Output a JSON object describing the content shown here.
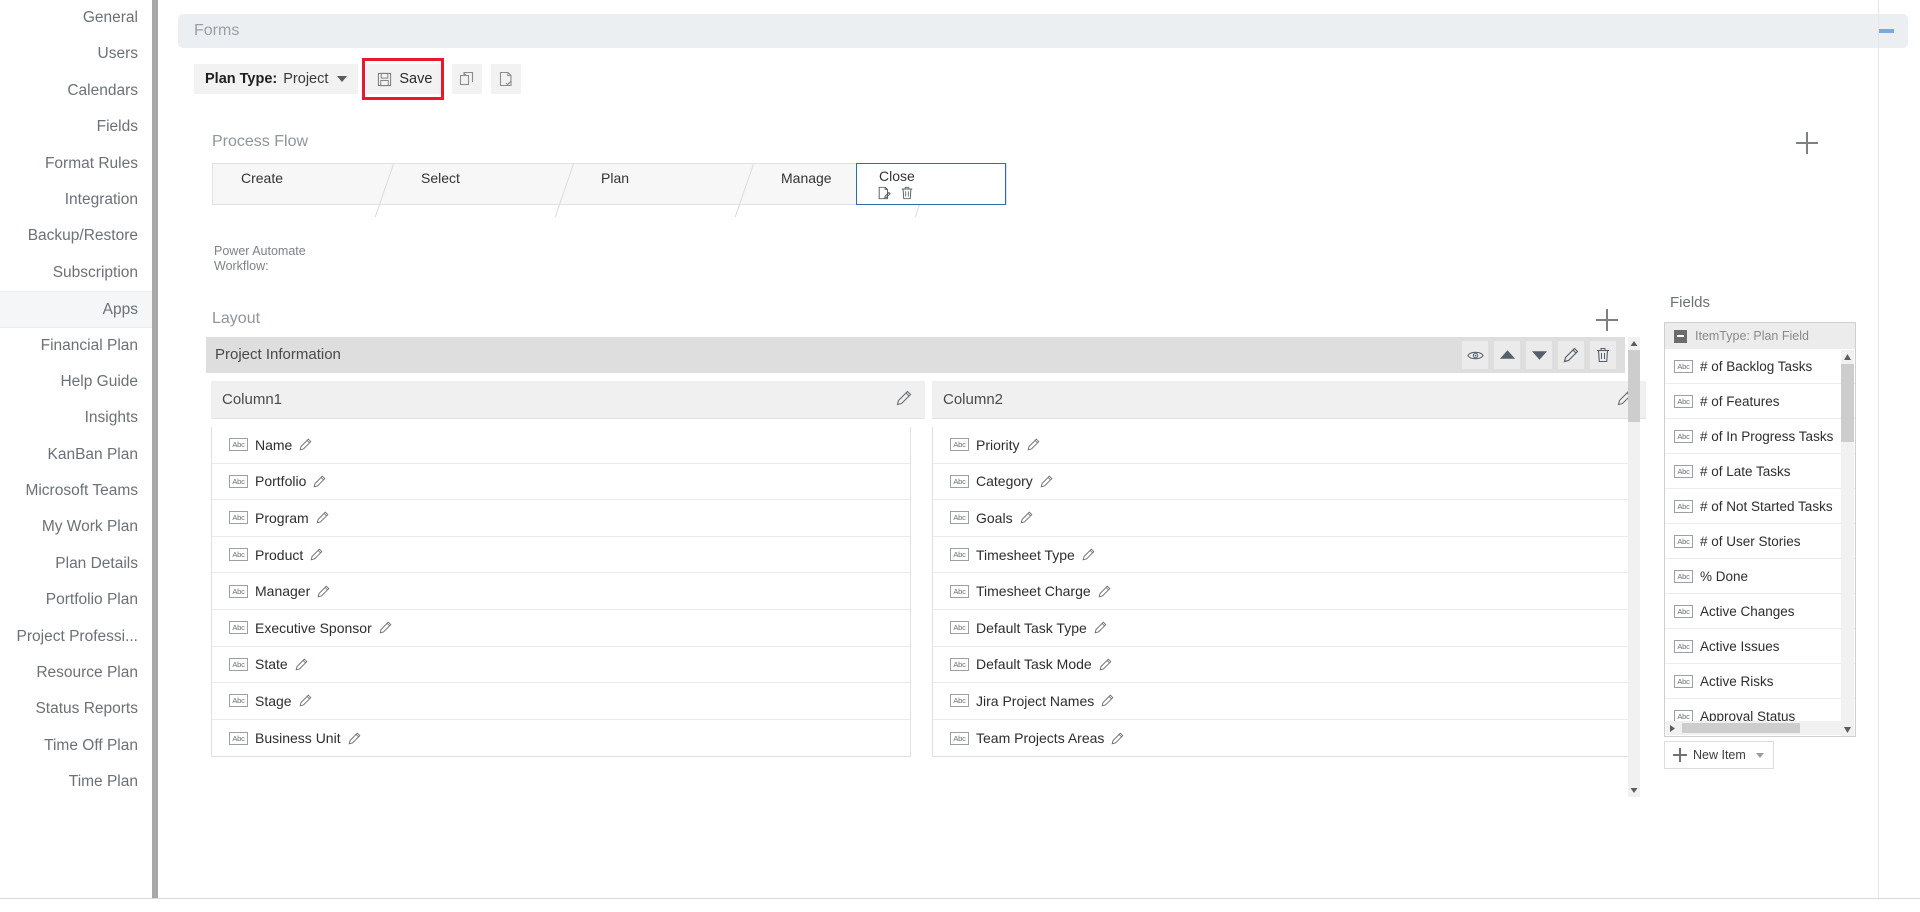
{
  "sidebar": {
    "items": [
      {
        "label": "General",
        "state": "normal"
      },
      {
        "label": "Users",
        "state": "normal"
      },
      {
        "label": "Calendars",
        "state": "normal"
      },
      {
        "label": "Fields",
        "state": "normal"
      },
      {
        "label": "Format Rules",
        "state": "normal"
      },
      {
        "label": "Integration",
        "state": "normal"
      },
      {
        "label": "Backup/Restore",
        "state": "normal"
      },
      {
        "label": "Subscription",
        "state": "normal"
      },
      {
        "label": "Apps",
        "state": "selected"
      },
      {
        "label": "Financial Plan",
        "state": "normal"
      },
      {
        "label": "Help Guide",
        "state": "normal"
      },
      {
        "label": "Insights",
        "state": "normal"
      },
      {
        "label": "KanBan Plan",
        "state": "normal"
      },
      {
        "label": "Microsoft Teams",
        "state": "normal"
      },
      {
        "label": "My Work Plan",
        "state": "normal"
      },
      {
        "label": "Plan Details",
        "state": "active"
      },
      {
        "label": "Portfolio Plan",
        "state": "normal"
      },
      {
        "label": "Project Professi...",
        "state": "normal"
      },
      {
        "label": "Resource Plan",
        "state": "normal"
      },
      {
        "label": "Status Reports",
        "state": "normal"
      },
      {
        "label": "Time Off Plan",
        "state": "normal"
      },
      {
        "label": "Time Plan",
        "state": "normal"
      }
    ]
  },
  "window": {
    "title": "Forms",
    "minimize_icon": "minimize-icon"
  },
  "toolbar": {
    "plan_type_label": "Plan Type:",
    "plan_type_value": "Project",
    "save_label": "Save",
    "save_icon": "floppy-disk-icon",
    "copy_icon": "copy-icon",
    "new-doc_icon": "new-document-icon",
    "highlight_color": "#e8192c"
  },
  "process_flow": {
    "title": "Process Flow",
    "add_icon": "plus-icon",
    "steps": [
      {
        "label": "Create",
        "selected": false
      },
      {
        "label": "Select",
        "selected": false
      },
      {
        "label": "Plan",
        "selected": false
      },
      {
        "label": "Manage",
        "selected": false
      },
      {
        "label": "Close",
        "selected": true
      }
    ],
    "selected_step_icons": [
      "edit-document-icon",
      "trash-icon"
    ],
    "selected_border_color": "#2e6da4"
  },
  "power_automate": {
    "label": "Power Automate Workflow:",
    "value": "",
    "caret_icon": "caret-down-icon"
  },
  "layout": {
    "title": "Layout",
    "add_icon": "plus-icon",
    "section_title": "Project Information",
    "section_tools": [
      {
        "icon": "eye-icon",
        "name": "visibility"
      },
      {
        "icon": "arrow-up-icon",
        "name": "move-up"
      },
      {
        "icon": "arrow-down-icon",
        "name": "move-down"
      },
      {
        "icon": "pencil-icon",
        "name": "edit"
      },
      {
        "icon": "trash-icon",
        "name": "delete"
      }
    ],
    "columns": [
      {
        "header": "Column1",
        "edit_icon": "pencil-icon",
        "fields": [
          {
            "type_icon": "Abc",
            "label": "Name"
          },
          {
            "type_icon": "Abc",
            "label": "Portfolio"
          },
          {
            "type_icon": "Abc",
            "label": "Program"
          },
          {
            "type_icon": "Abc",
            "label": "Product"
          },
          {
            "type_icon": "Abc",
            "label": "Manager"
          },
          {
            "type_icon": "Abc",
            "label": "Executive Sponsor"
          },
          {
            "type_icon": "Abc",
            "label": "State"
          },
          {
            "type_icon": "Abc",
            "label": "Stage"
          },
          {
            "type_icon": "Abc",
            "label": "Business Unit"
          }
        ]
      },
      {
        "header": "Column2",
        "edit_icon": "pencil-icon",
        "fields": [
          {
            "type_icon": "Abc",
            "label": "Priority"
          },
          {
            "type_icon": "Abc",
            "label": "Category"
          },
          {
            "type_icon": "Abc",
            "label": "Goals"
          },
          {
            "type_icon": "Abc",
            "label": "Timesheet Type"
          },
          {
            "type_icon": "Abc",
            "label": "Timesheet Charge"
          },
          {
            "type_icon": "Abc",
            "label": "Default Task Type"
          },
          {
            "type_icon": "Abc",
            "label": "Default Task Mode"
          },
          {
            "type_icon": "Abc",
            "label": "Jira Project Names"
          },
          {
            "type_icon": "Abc",
            "label": "Team Projects Areas"
          }
        ]
      }
    ]
  },
  "fields_panel": {
    "title": "Fields",
    "group_label": "ItemType: Plan Field",
    "group_collapse_icon": "minus-square-icon",
    "items": [
      {
        "type_icon": "Abc",
        "label": "# of Backlog Tasks"
      },
      {
        "type_icon": "Abc",
        "label": "# of Features"
      },
      {
        "type_icon": "Abc",
        "label": "# of In Progress Tasks"
      },
      {
        "type_icon": "Abc",
        "label": "# of Late Tasks"
      },
      {
        "type_icon": "Abc",
        "label": "# of Not Started Tasks"
      },
      {
        "type_icon": "Abc",
        "label": "# of User Stories"
      },
      {
        "type_icon": "Abc",
        "label": "% Done"
      },
      {
        "type_icon": "Abc",
        "label": "Active Changes"
      },
      {
        "type_icon": "Abc",
        "label": "Active Issues"
      },
      {
        "type_icon": "Abc",
        "label": "Active Risks"
      },
      {
        "type_icon": "Abc",
        "label": "Approval Status"
      }
    ],
    "new_item_label": "New Item",
    "new_item_icon": "plus-icon"
  }
}
